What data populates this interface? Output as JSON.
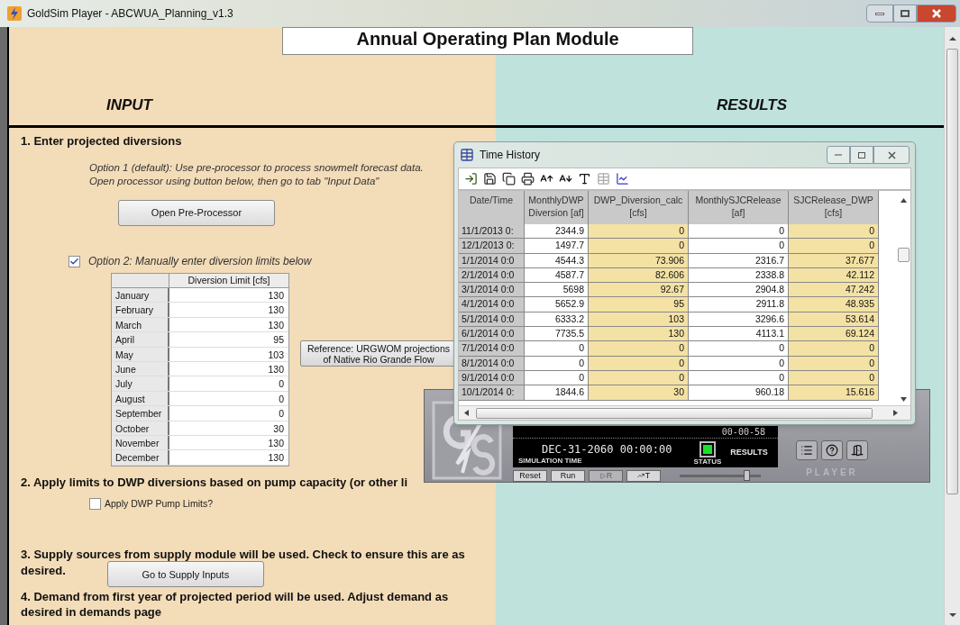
{
  "window": {
    "title": "GoldSim Player - ABCWUA_Planning_v1.3"
  },
  "header": {
    "title": "Annual Operating Plan Module",
    "input_label": "INPUT",
    "results_label": "RESULTS"
  },
  "step1": {
    "heading": "1. Enter projected diversions",
    "option1_text": "Option 1 (default): Use pre-processor to process snowmelt forecast data. Open processor using button below, then go to tab \"Input Data\"",
    "button": "Open Pre-Processor",
    "option2": {
      "label": "Option 2: Manually enter diversion limits below",
      "checked": true
    },
    "table": {
      "column": "Diversion Limit [cfs]",
      "rows": [
        {
          "month": "January",
          "value": "130"
        },
        {
          "month": "February",
          "value": "130"
        },
        {
          "month": "March",
          "value": "130"
        },
        {
          "month": "April",
          "value": "95"
        },
        {
          "month": "May",
          "value": "103"
        },
        {
          "month": "June",
          "value": "130"
        },
        {
          "month": "July",
          "value": "0"
        },
        {
          "month": "August",
          "value": "0"
        },
        {
          "month": "September",
          "value": "0"
        },
        {
          "month": "October",
          "value": "30"
        },
        {
          "month": "November",
          "value": "130"
        },
        {
          "month": "December",
          "value": "130"
        }
      ]
    },
    "reference_button": "Reference: URGWOM projections of Native Rio Grande Flow"
  },
  "step2": {
    "heading": "2. Apply limits to DWP diversions based on pump capacity (or other li",
    "checkbox": {
      "label": "Apply DWP Pump Limits?",
      "checked": false
    }
  },
  "step3": {
    "heading_lines": [
      "3. Supply sources from supply module will be used. Check to ensure this are as",
      "desired."
    ],
    "button": "Go to Supply Inputs"
  },
  "step4": {
    "heading": "4. Demand from first year of projected period will be used. Adjust demand as desired in demands page"
  },
  "time_history": {
    "title": "Time History",
    "columns": [
      {
        "label": "Date/Time"
      },
      {
        "label": "MonthlyDWP Diversion [af]",
        "highlighted": false
      },
      {
        "label": "DWP_Diversion_calc [cfs]",
        "highlighted": true
      },
      {
        "label": "MonthlySJCRelease [af]",
        "highlighted": false
      },
      {
        "label": "SJCRelease_DWP [cfs]",
        "highlighted": true
      }
    ],
    "rows": [
      [
        "11/1/2013 0:",
        "2344.9",
        "0",
        "0",
        "0"
      ],
      [
        "12/1/2013 0:",
        "1497.7",
        "0",
        "0",
        "0"
      ],
      [
        "1/1/2014 0:0",
        "4544.3",
        "73.906",
        "2316.7",
        "37.677"
      ],
      [
        "2/1/2014 0:0",
        "4587.7",
        "82.606",
        "2338.8",
        "42.112"
      ],
      [
        "3/1/2014 0:0",
        "5698",
        "92.67",
        "2904.8",
        "47.242"
      ],
      [
        "4/1/2014 0:0",
        "5652.9",
        "95",
        "2911.8",
        "48.935"
      ],
      [
        "5/1/2014 0:0",
        "6333.2",
        "103",
        "3296.6",
        "53.614"
      ],
      [
        "6/1/2014 0:0",
        "7735.5",
        "130",
        "4113.1",
        "69.124"
      ],
      [
        "7/1/2014 0:0",
        "0",
        "0",
        "0",
        "0"
      ],
      [
        "8/1/2014 0:0",
        "0",
        "0",
        "0",
        "0"
      ],
      [
        "9/1/2014 0:0",
        "0",
        "0",
        "0",
        "0"
      ],
      [
        "10/1/2014 0:",
        "1844.6",
        "30",
        "960.18",
        "15.616"
      ]
    ]
  },
  "player": {
    "clock": "00-00-58",
    "sim_time": "DEC-31-2060 00:00:00",
    "sim_time_label": "SIMULATION TIME",
    "status_label": "STATUS",
    "status_text": "RESULTS",
    "buttons": [
      {
        "label": "Reset",
        "disabled": false
      },
      {
        "label": "Run",
        "disabled": false
      },
      {
        "label": "R",
        "disabled": true
      },
      {
        "label": "T",
        "disabled": false
      }
    ],
    "brand": "PLAYER",
    "speed": {
      "level": 0.82
    }
  }
}
